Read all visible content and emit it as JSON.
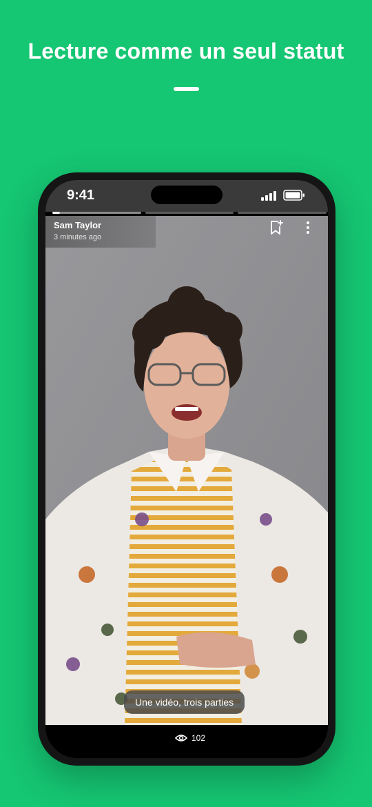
{
  "hero": {
    "title": "Lecture comme un seul statut"
  },
  "statusbar": {
    "time": "9:41"
  },
  "story": {
    "author": "Sam Taylor",
    "posted": "3 minutes ago",
    "segments": 3,
    "active_segment": 1,
    "caption": "Une vidéo, trois parties",
    "views": "102"
  },
  "icons": {
    "bookmark": "bookmark-add-icon",
    "more": "more-vert-icon",
    "eye": "eye-icon"
  },
  "colors": {
    "background": "#15c672",
    "caption_bg": "#4b4b4b"
  }
}
